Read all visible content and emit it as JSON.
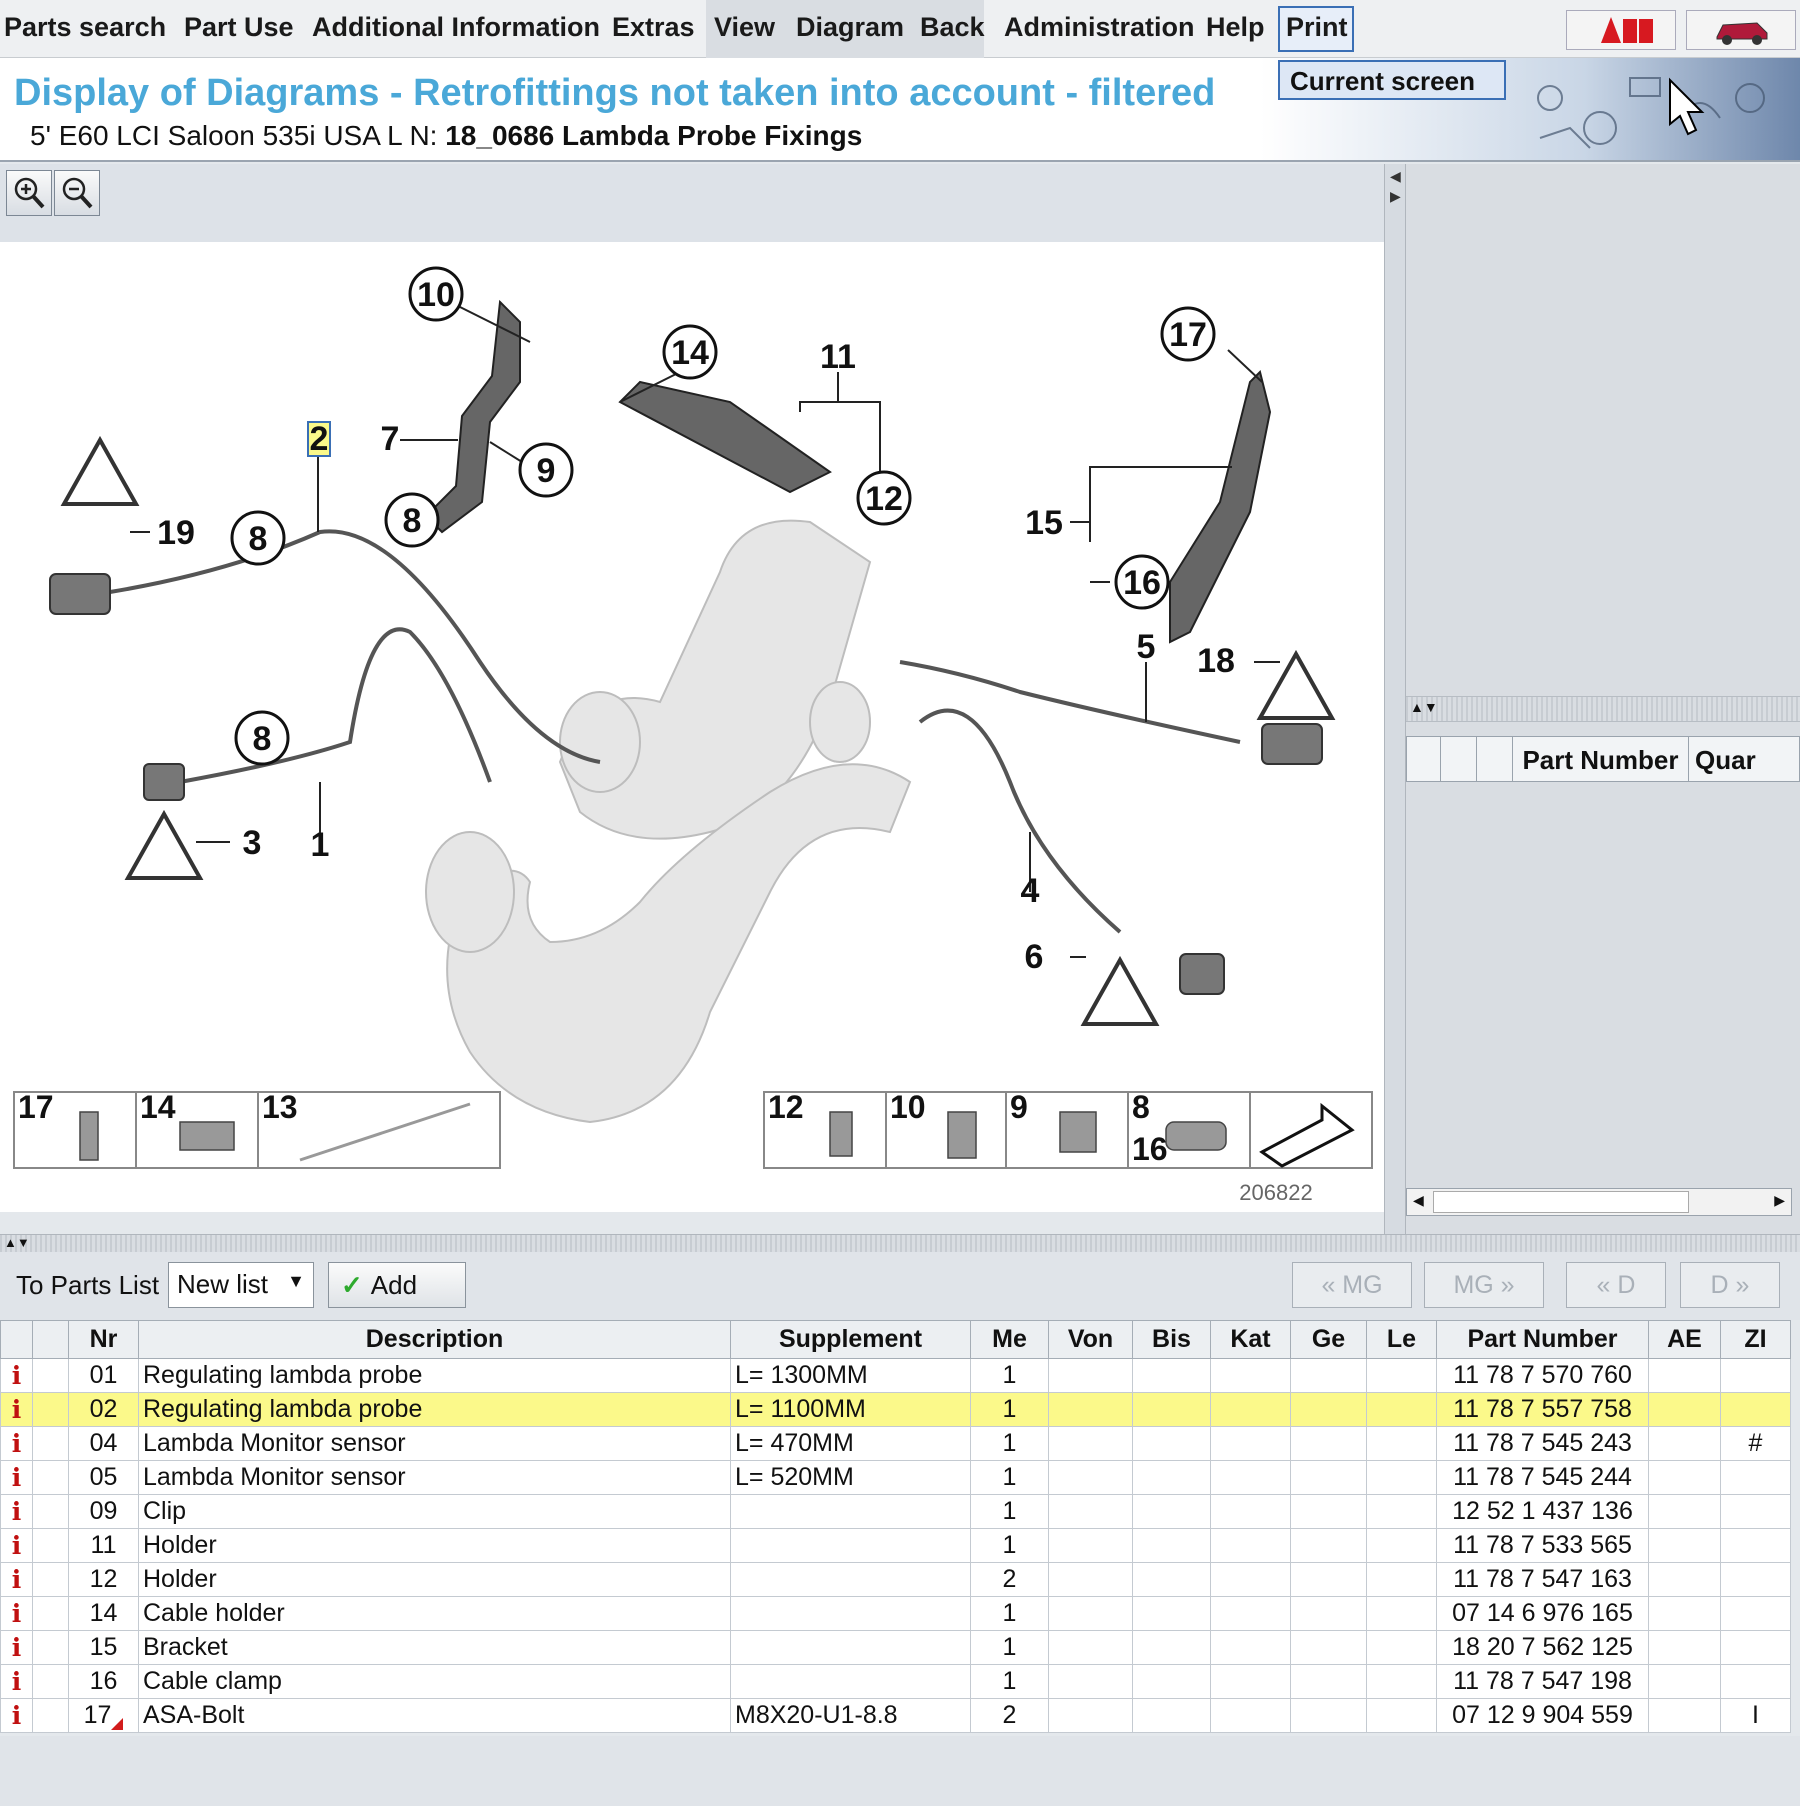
{
  "menu": {
    "items": [
      "Parts search",
      "Part Use",
      "Additional Information",
      "Extras",
      "View",
      "Diagram",
      "Back",
      "Administration",
      "Help",
      "Print"
    ],
    "dropdown": "Current screen"
  },
  "header": {
    "title": "Display of Diagrams - Retrofittings not taken into account - filtered",
    "vehicle": "5' E60 LCI Saloon 535i USA  L N:",
    "group": "18_0686 Lambda Probe Fixings"
  },
  "diagram": {
    "callouts": [
      "10",
      "2",
      "7",
      "9",
      "8",
      "14",
      "11",
      "12",
      "17",
      "15",
      "16",
      "19",
      "8",
      "5",
      "18",
      "8",
      "3",
      "1",
      "4",
      "6"
    ],
    "legend": [
      "17",
      "14",
      "13",
      "12",
      "10",
      "9",
      "8",
      "16"
    ],
    "image_number": "206822"
  },
  "right_panel": {
    "columns": [
      "Part Number",
      "Quar"
    ]
  },
  "parts_toolbar": {
    "label": "To Parts List",
    "list_value": "New list",
    "add_label": "Add",
    "nav": [
      "« MG",
      "MG »",
      "« D",
      "D »"
    ]
  },
  "table": {
    "columns": [
      "Nr",
      "Description",
      "Supplement",
      "Me",
      "Von",
      "Bis",
      "Kat",
      "Ge",
      "Le",
      "Part Number",
      "AE",
      "ZI"
    ],
    "rows": [
      {
        "nr": "01",
        "desc": "Regulating lambda probe",
        "supp": "L= 1300MM",
        "me": "1",
        "pn": "11 78 7 570 760",
        "zi": "",
        "selected": false
      },
      {
        "nr": "02",
        "desc": "Regulating lambda probe",
        "supp": "L= 1100MM",
        "me": "1",
        "pn": "11 78 7 557 758",
        "zi": "",
        "selected": true
      },
      {
        "nr": "04",
        "desc": "Lambda Monitor sensor",
        "supp": "L= 470MM",
        "me": "1",
        "pn": "11 78 7 545 243",
        "zi": "#",
        "selected": false
      },
      {
        "nr": "05",
        "desc": "Lambda Monitor sensor",
        "supp": "L= 520MM",
        "me": "1",
        "pn": "11 78 7 545 244",
        "zi": "",
        "selected": false
      },
      {
        "nr": "09",
        "desc": "Clip",
        "supp": "",
        "me": "1",
        "pn": "12 52 1 437 136",
        "zi": "",
        "selected": false
      },
      {
        "nr": "11",
        "desc": "Holder",
        "supp": "",
        "me": "1",
        "pn": "11 78 7 533 565",
        "zi": "",
        "selected": false
      },
      {
        "nr": "12",
        "desc": "Holder",
        "supp": "",
        "me": "2",
        "pn": "11 78 7 547 163",
        "zi": "",
        "selected": false
      },
      {
        "nr": "14",
        "desc": "Cable holder",
        "supp": "",
        "me": "1",
        "pn": "07 14 6 976 165",
        "zi": "",
        "selected": false
      },
      {
        "nr": "15",
        "desc": "Bracket",
        "supp": "",
        "me": "1",
        "pn": "18 20 7 562 125",
        "zi": "",
        "selected": false
      },
      {
        "nr": "16",
        "desc": "Cable clamp",
        "supp": "",
        "me": "1",
        "pn": "11 78 7 547 198",
        "zi": "",
        "selected": false
      },
      {
        "nr": "17",
        "desc": "ASA-Bolt",
        "supp": "M8X20-U1-8.8",
        "me": "2",
        "pn": "07 12 9 904 559",
        "zi": "I",
        "selected": false
      }
    ]
  },
  "icons": {
    "info": "i",
    "zoom_in": "zoom-in-icon",
    "zoom_out": "zoom-out-icon"
  },
  "colors": {
    "title": "#4aa8d8",
    "selected_row": "#fbf98a",
    "info_icon": "#c01010"
  }
}
